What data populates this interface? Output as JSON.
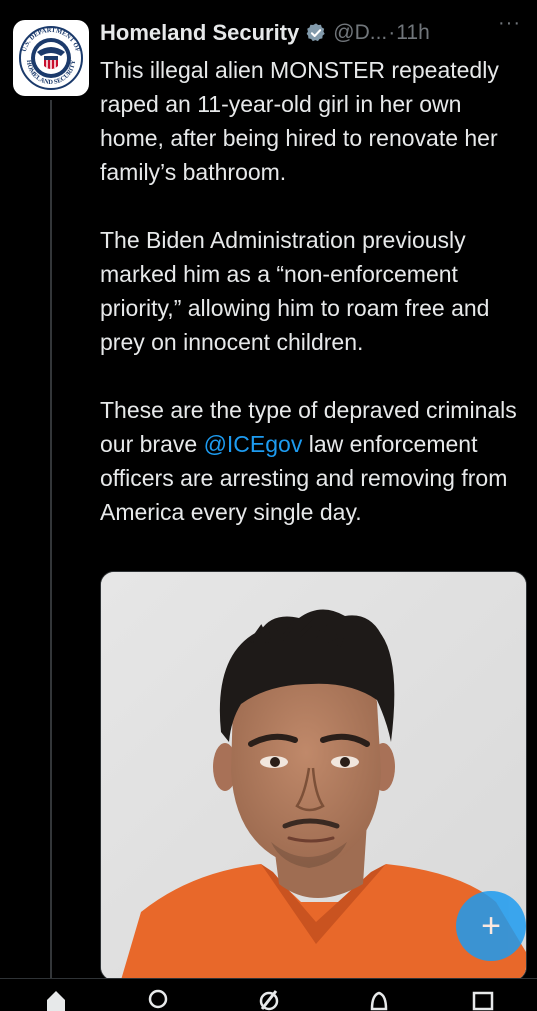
{
  "tweet": {
    "author_name": "Homeland Security",
    "handle": "@D...",
    "separator": "·",
    "time": "11h",
    "more_label": "···",
    "paragraphs": {
      "p1": "This illegal alien MONSTER repeatedly raped an 11-year-old girl in her own home, after being hired to renovate her family’s bathroom.",
      "p2": "The Biden Administration previously marked him as a “non-enforcement priority,” allowing him to roam free and prey on innocent children.",
      "p3_before": "These are the type of depraved criminals our brave ",
      "p3_mention": "@ICEgov",
      "p3_after": " law enforcement officers are arresting and removing from America every single day."
    }
  },
  "avatar": {
    "seal_text_top": "U.S. DEPARTMENT OF",
    "seal_text_bottom": "HOMELAND SECURITY"
  },
  "fab": {
    "label": "+"
  },
  "colors": {
    "background": "#000000",
    "text": "#e7e9ea",
    "muted": "#71767b",
    "accent": "#1d9bf0",
    "jumpsuit": "#e8682a"
  },
  "icons": {
    "verified": "verified-badge-icon",
    "nav": [
      "home-icon",
      "search-icon",
      "grok-icon",
      "notifications-icon",
      "messages-icon"
    ]
  }
}
